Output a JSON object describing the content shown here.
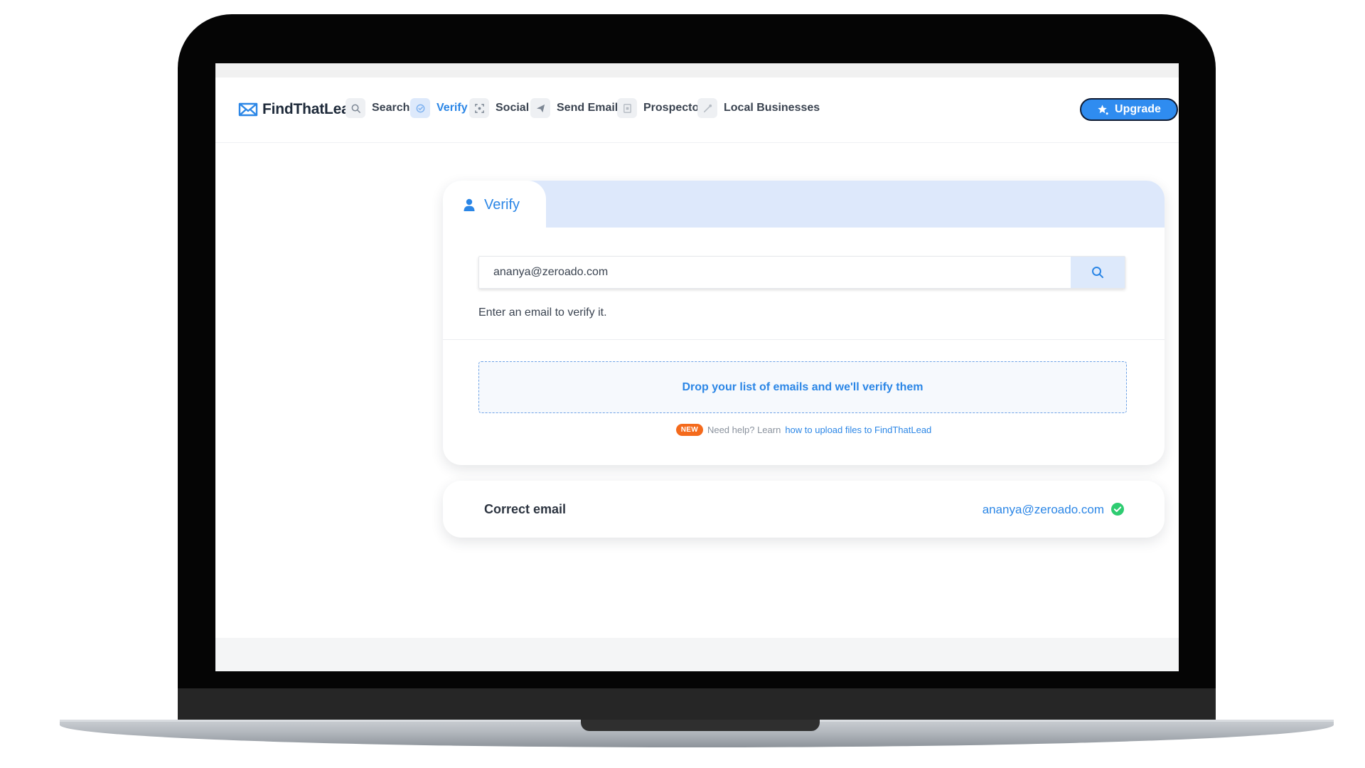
{
  "app": {
    "name": "FindThatLead"
  },
  "nav": {
    "items": [
      {
        "label": "Search",
        "icon": "search-icon",
        "active": false
      },
      {
        "label": "Verify",
        "icon": "verify-icon",
        "active": true
      },
      {
        "label": "Social",
        "icon": "social-icon",
        "active": false
      },
      {
        "label": "Send Emails",
        "icon": "send-icon",
        "active": false
      },
      {
        "label": "Prospector",
        "icon": "prospector-icon",
        "active": false
      },
      {
        "label": "Local Businesses",
        "icon": "local-businesses-icon",
        "active": false
      }
    ],
    "upgrade_label": "Upgrade"
  },
  "verify_card": {
    "tab_label": "Verify",
    "email_value": "ananya@zeroado.com",
    "helper_text": "Enter an email to verify it.",
    "dropzone_text": "Drop your list of emails and we'll verify them",
    "badge": "NEW",
    "help_prefix": "Need help? Learn",
    "help_link": "how to upload files to FindThatLead"
  },
  "result": {
    "label": "Correct email",
    "email": "ananya@zeroado.com",
    "status": "valid"
  },
  "colors": {
    "accent": "#2b86e6",
    "upgrade": "#2f8cf0",
    "badge": "#f46a1c",
    "valid": "#2ecc71",
    "tab_band": "#dde8fb"
  }
}
